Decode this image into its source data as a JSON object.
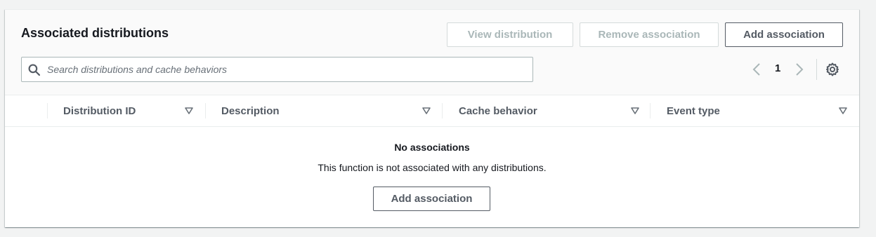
{
  "panel": {
    "title": "Associated distributions",
    "actions": {
      "view_label": "View distribution",
      "remove_label": "Remove association",
      "add_label": "Add association"
    },
    "search": {
      "placeholder": "Search distributions and cache behaviors",
      "value": "",
      "icon": "search-icon"
    },
    "pagination": {
      "current_page": "1",
      "prev_icon": "chevron-left-icon",
      "next_icon": "chevron-right-icon",
      "settings_icon": "gear-icon"
    },
    "table": {
      "columns": [
        {
          "label": "Distribution ID"
        },
        {
          "label": "Description"
        },
        {
          "label": "Cache behavior"
        },
        {
          "label": "Event type"
        }
      ],
      "sort_icon": "caret-down-icon",
      "rows": []
    },
    "empty_state": {
      "title": "No associations",
      "message": "This function is not associated with any distributions.",
      "action_label": "Add association"
    }
  }
}
